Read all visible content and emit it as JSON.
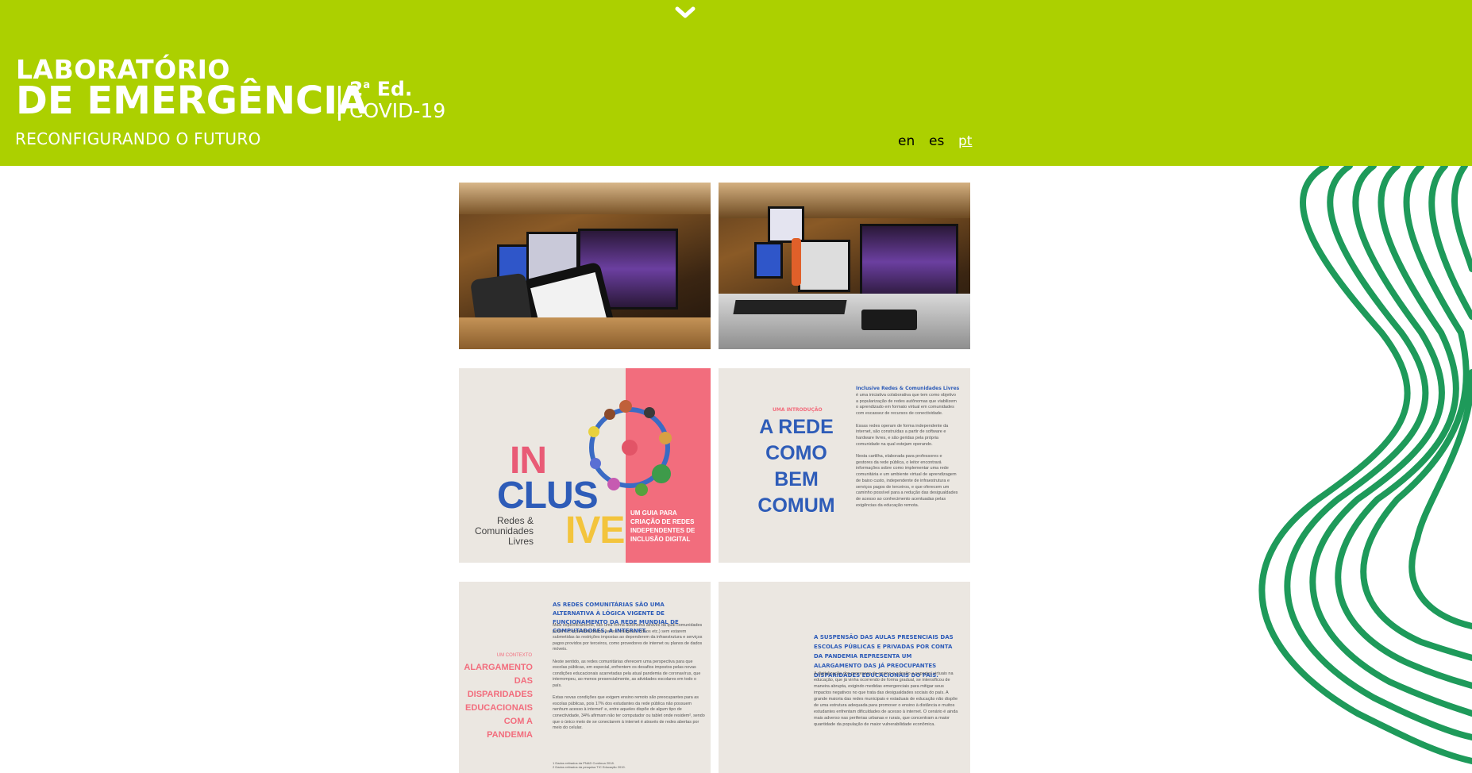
{
  "header": {
    "title_line1": "LABORATÓRIO",
    "title_line2": "DE EMERGÊNCIA",
    "edition_num": "2",
    "edition_sup": "a",
    "edition_label": "Ed.",
    "edition_sub": "COVID-19",
    "tagline": "RECONFIGURANDO O FUTURO",
    "languages": [
      "en",
      "es",
      "pt"
    ],
    "active_language": "pt"
  },
  "gallery": {
    "cover": {
      "word1": "IN",
      "word2": "CLUS",
      "word3": "IVE",
      "sub1": "Redes &",
      "sub2": "Comunidades",
      "sub3": "Livres",
      "guide": [
        "UM GUIA PARA",
        "CRIAÇÃO DE REDES",
        "INDEPENDENTES DE",
        "INCLUSÃO DIGITAL"
      ]
    },
    "intro": {
      "kicker": "UMA INTRODUÇÃO",
      "title": [
        "A REDE",
        "COMO",
        "BEM",
        "COMUM"
      ],
      "body_title": "Inclusive Redes & Comunidades Livres",
      "body": "é uma iniciativa colaborativa que tem como objetivo a popularização de redes autônomas que viabilizem o aprendizado em formato virtual em comunidades com escassez de recursos de conectividade.\n\nEssas redes operam de forma independente da internet, são construídas a partir de software e hardware livres, e são geridas pela própria comunidade na qual estejam operando.\n\nNesta cartilha, elaborada para professores e gestores da rede pública, o leitor encontrará informações sobre como implementar uma rede comunitária e um ambiente virtual de aprendizagem de baixo custo, independente de infraestrutura e serviços pagos de terceiros, e que oferecem um caminho possível para a redução das desigualdades de acesso ao conhecimento acentuadas pelas exigências da educação remota."
    },
    "context": {
      "kicker": "UM CONTEXTO",
      "title": [
        "ALARGAMENTO",
        "DAS DISPARIDADES",
        "EDUCACIONAIS",
        "COM A PANDEMIA"
      ],
      "lead": "AS REDES COMUNITÁRIAS SÃO UMA ALTERNATIVA À LÓGICA VIGENTE DE FUNCIONAMENTO DA REDE MUNDIAL DE COMPUTADORES, A INTERNET.",
      "body": "Mais especificamente, são uma forma autônoma através da qual comunidades podem compartilhar dados (textos, imagens, vídeos etc.) sem estarem submetidas às restrições impostas ao dependerem da infraestrutura e serviços pagos providos por terceiros, como provedores de internet ou planos de dados móveis.\n\nNeste sentido, as redes comunitárias oferecem uma perspectiva para que escolas públicas, em especial, enfrentem os desafios impostos pelas novas condições educacionais acarretadas pela atual pandemia de coronavírus, que interrompeu, ao menos presencialmente, as atividades escolares em todo o país.\n\nEstas novas condições que exigem ensino remoto são preocupantes para as escolas públicas, pois 17% dos estudantes da rede pública não possuem nenhum acesso à internet¹ e, entre aqueles dispõe de algum tipo de conectividade, 34% afirmam não ter computador ou tablet onde residem², sendo que o único meio de se conectarem à internet é através de redes abertas por meio do celular.",
      "footnotes": "1 Dados retirados da PNAD Contínua 2018.\n2 Dados retirados da pesquisa TIC Educação 2019."
    },
    "suspension": {
      "lead": "A SUSPENSÃO DAS AULAS PRESENCIAIS DAS ESCOLAS PÚBLICAS E PRIVADAS POR CONTA DA PANDEMIA REPRESENTA UM ALARGAMENTO DAS JÁ PREOCUPANTES DISPARIDADES EDUCACIONAIS DO PAÍS.",
      "body": "A digitalização dos processos de ensino e adesão a suportes virtuais na educação, que já vinha ocorrendo de forma gradual, se intensificou de maneira abrupta, exigindo medidas emergenciais para mitigar seus impactos negativos no que trata das desigualdades sociais do país. A grande maioria das redes municipais e estaduais de educação não dispõe de uma estrutura adequada para promover o ensino à distância e muitos estudantes enfrentam dificuldades de acesso à internet. O cenário é ainda mais adverso nas periferias urbanas e rurais, que concentram a maior quantidade da população de maior vulnerabilidade econômica."
    }
  },
  "colors": {
    "header_bg": "#acd000",
    "accent_green": "#1e9a5a",
    "pink": "#f26d7d",
    "blue": "#2e5cb8"
  },
  "icons": {
    "chevron": "chevron-down-icon",
    "decoration": "wavy-lines-decoration"
  }
}
